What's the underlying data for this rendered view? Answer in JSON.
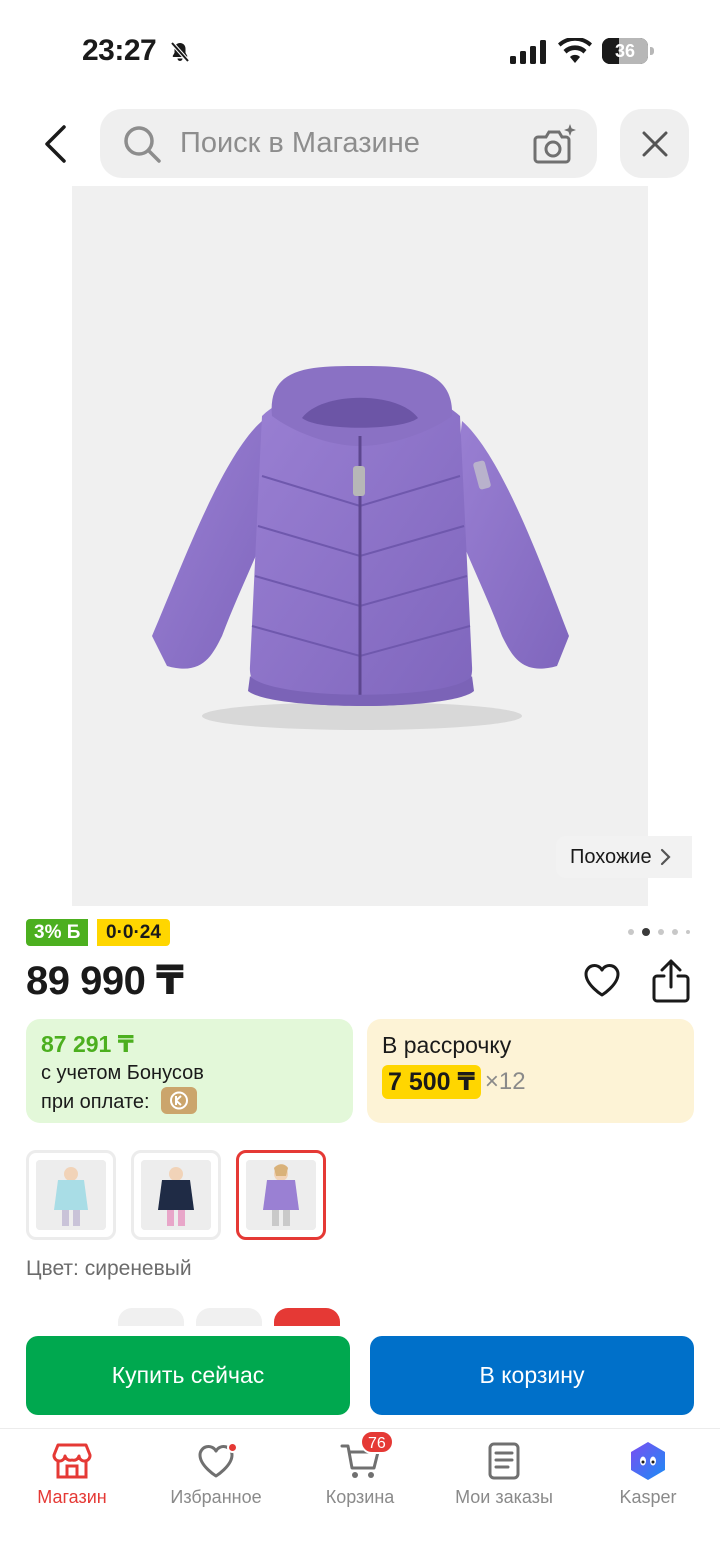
{
  "status_bar": {
    "time": "23:27",
    "battery": "36",
    "battery_level": 0.36
  },
  "search": {
    "placeholder": "Поиск в Магазине"
  },
  "product": {
    "similar_label": "Похожие",
    "cashback_badge": "3% Б",
    "installment_badge": "0·0·24",
    "price": "89 990 ₸",
    "image_index": 2,
    "image_count": 5
  },
  "bonus_card": {
    "price": "87 291 ₸",
    "line1": "с учетом Бонусов",
    "line2": "при оплате:"
  },
  "installment_card": {
    "title": "В рассрочку",
    "amount": "7 500 ₸",
    "months": "×12"
  },
  "colors": {
    "label": "Цвет: сиреневый",
    "options": [
      "light-blue",
      "navy",
      "lilac"
    ],
    "selected_index": 2
  },
  "actions": {
    "buy_now": "Купить сейчас",
    "to_cart": "В корзину"
  },
  "tabbar": {
    "items": [
      {
        "label": "Магазин",
        "icon": "store-icon",
        "active": true
      },
      {
        "label": "Избранное",
        "icon": "heart-icon"
      },
      {
        "label": "Корзина",
        "icon": "cart-icon"
      },
      {
        "label": "Мои заказы",
        "icon": "orders-icon"
      },
      {
        "label": "Kasper",
        "icon": "kasper-icon"
      }
    ],
    "cart_badge": "76"
  },
  "colors_theme": {
    "accent_red": "#e53935",
    "green": "#00a84f",
    "blue": "#0070c9",
    "yellow": "#ffd600",
    "jacket_purple": "#8d74c9"
  }
}
